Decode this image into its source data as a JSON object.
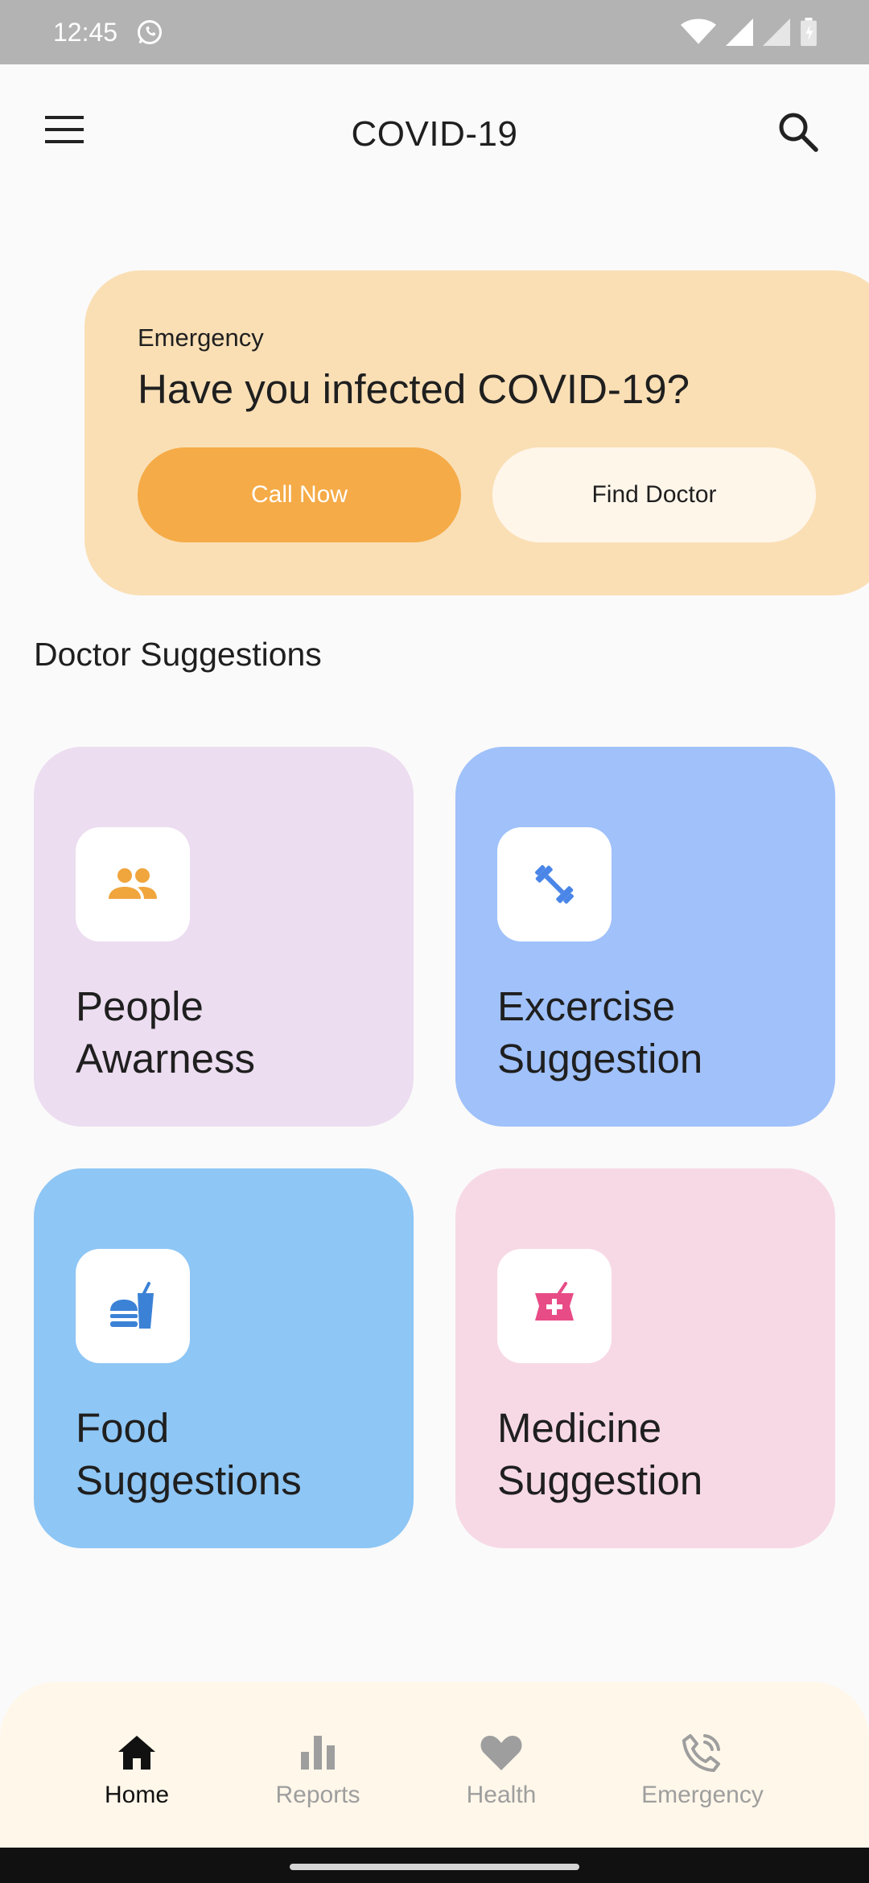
{
  "status_bar": {
    "time": "12:45",
    "icons": [
      "whatsapp-icon",
      "wifi-icon",
      "signal-icon",
      "signal-icon",
      "battery-icon"
    ]
  },
  "app_bar": {
    "title": "COVID-19",
    "icons": [
      "menu-icon",
      "search-icon"
    ]
  },
  "emergency": {
    "label": "Emergency",
    "question": "Have you infected COVID-19?",
    "call_button": "Call Now",
    "find_button": "Find Doctor",
    "colors": {
      "card": "#fadfb5",
      "call": "#f5ab47",
      "find": "#fff6ea"
    }
  },
  "suggestions": {
    "title": "Doctor Suggestions",
    "items": [
      {
        "label": "People\nAwarness",
        "icon": "people-icon",
        "color": "#ecddf0",
        "icon_color": "#f0a53d"
      },
      {
        "label": "Excercise\nSuggestion",
        "icon": "dumbbell-icon",
        "color": "#a0c1fa",
        "icon_color": "#4a86e8"
      },
      {
        "label": "Food\nSuggestions",
        "icon": "fastfood-icon",
        "color": "#8ec6f5",
        "icon_color": "#3b82d6"
      },
      {
        "label": "Medicine\nSuggestion",
        "icon": "medicine-icon",
        "color": "#f7d9e5",
        "icon_color": "#e84c86"
      }
    ]
  },
  "bottom_nav": {
    "items": [
      {
        "label": "Home",
        "icon": "home-icon",
        "active": true
      },
      {
        "label": "Reports",
        "icon": "bar-chart-icon",
        "active": false
      },
      {
        "label": "Health",
        "icon": "heart-icon",
        "active": false
      },
      {
        "label": "Emergency",
        "icon": "phone-call-icon",
        "active": false
      }
    ]
  }
}
